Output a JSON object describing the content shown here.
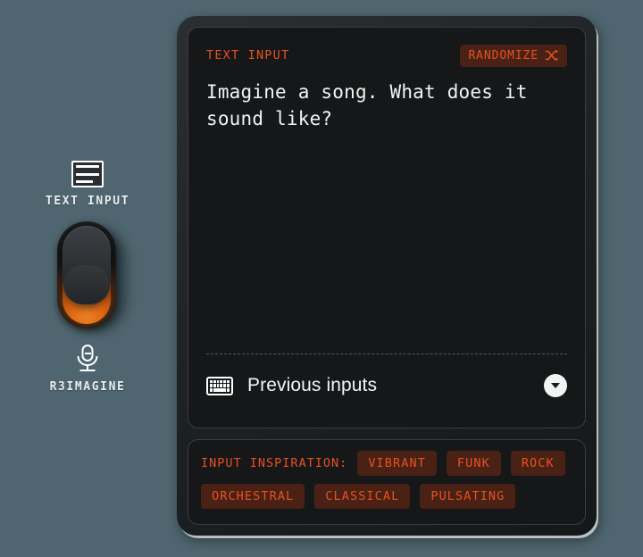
{
  "sidebar": {
    "top": {
      "icon": "text-document-icon",
      "label": "TEXT INPUT"
    },
    "toggle": {
      "name": "mode-toggle-switch",
      "state": "on"
    },
    "bottom": {
      "icon": "microphone-icon",
      "label": "R3IMAGINE"
    }
  },
  "device": {
    "main_panel": {
      "section_label": "TEXT INPUT",
      "randomize": {
        "label": "RANDOMIZE",
        "icon": "shuffle-icon"
      },
      "prompt_value": "Imagine a song. What does it sound like?",
      "prompt_placeholder": "Imagine a song. What does it sound like?",
      "previous_inputs": {
        "icon": "keyboard-icon",
        "label": "Previous inputs",
        "expand_icon": "chevron-down-icon"
      }
    },
    "inspiration_panel": {
      "label": "INPUT INSPIRATION:",
      "tags": [
        "VIBRANT",
        "FUNK",
        "ROCK",
        "ORCHESTRAL",
        "CLASSICAL",
        "PULSATING"
      ]
    }
  },
  "colors": {
    "background": "#4f6670",
    "accent_orange": "#e8511f",
    "tag_background": "#4a2115",
    "panel_background": "#151719",
    "device_body": "#1e2224",
    "text_primary": "#f2f3f3",
    "toggle_glow": "#e26a14"
  }
}
